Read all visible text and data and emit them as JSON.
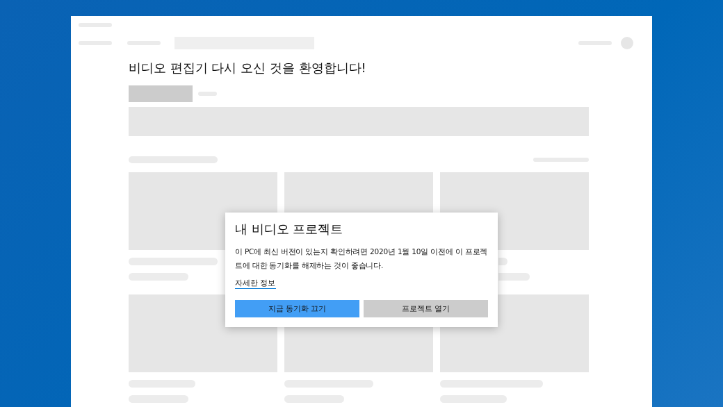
{
  "page": {
    "heading": "비디오 편집기 다시 오신 것을 환영합니다!"
  },
  "dialog": {
    "title": "내 비디오 프로젝트",
    "message": "이 PC에 최신 버전이 있는지 확인하려면 2020년 1월 10일 이전에 이 프로젝트에 대한 동기화를 해제하는 것이 좋습니다.",
    "link": "자세한 정보",
    "buttons": [
      {
        "label": "지금 동기화 끄기",
        "kind": "primary"
      },
      {
        "label": "프로젝트 열기",
        "kind": "secondary"
      }
    ]
  }
}
